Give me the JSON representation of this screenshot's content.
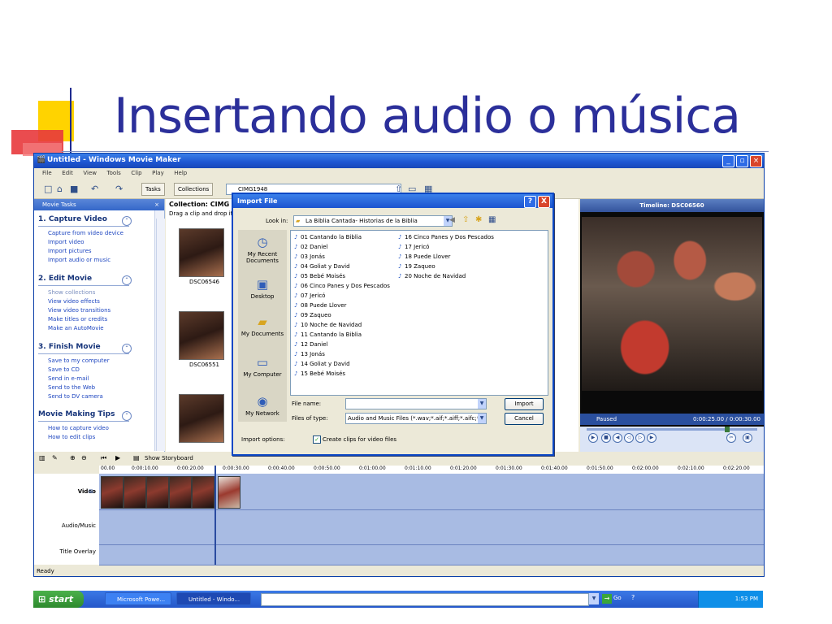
{
  "slide": {
    "title": "Insertando audio o música"
  },
  "window": {
    "title": "Untitled - Windows Movie Maker",
    "menu": [
      "File",
      "Edit",
      "View",
      "Tools",
      "Clip",
      "Play",
      "Help"
    ],
    "toolbar": {
      "tasks": "Tasks",
      "collections": "Collections",
      "collection_select": "CIMG1948"
    }
  },
  "tasks_pane": {
    "header": "Movie Tasks",
    "sections": [
      {
        "title": "1. Capture Video",
        "links": [
          "Capture from video device",
          "Import video",
          "Import pictures",
          "Import audio or music"
        ]
      },
      {
        "title": "2. Edit Movie",
        "links": [
          "Show collections",
          "View video effects",
          "View video transitions",
          "Make titles or credits",
          "Make an AutoMovie"
        ]
      },
      {
        "title": "3. Finish Movie",
        "links": [
          "Save to my computer",
          "Save to CD",
          "Send in e-mail",
          "Send to the Web",
          "Send to DV camera"
        ]
      },
      {
        "title": "Movie Making Tips",
        "links": [
          "How to capture video",
          "How to edit clips"
        ]
      }
    ]
  },
  "collection": {
    "title": "Collection: CIMG",
    "hint": "Drag a clip and drop it o",
    "items": [
      "DSC06546",
      "DSC06551"
    ]
  },
  "preview": {
    "header": "Timeline: DSC06560",
    "status": "Paused",
    "time": "0:00:25.00 / 0:00:30.00"
  },
  "dialog": {
    "title": "Import File",
    "look_in_label": "Look in:",
    "look_in_value": "La Biblia Cantada- Historias de la Biblia",
    "places": [
      "My Recent Documents",
      "Desktop",
      "My Documents",
      "My Computer",
      "My Network"
    ],
    "files_col1": [
      "01 Cantando la Biblia",
      "02 Daniel",
      "03 Jonás",
      "04 Goliat y David",
      "05 Bebé Moisés",
      "06 Cinco Panes y Dos Pescados",
      "07 Jericó",
      "08 Puede Llover",
      "09 Zaqueo",
      "10 Noche de Navidad",
      "11 Cantando la Biblia",
      "12 Daniel",
      "13 Jonás",
      "14 Goliat y David",
      "15 Bebé Moisés"
    ],
    "files_col2": [
      "16 Cinco Panes y Dos Pescados",
      "17 Jericó",
      "18 Puede Llover",
      "19 Zaqueo",
      "20 Noche de Navidad"
    ],
    "file_name_label": "File name:",
    "file_name_value": "",
    "files_of_type_label": "Files of type:",
    "files_of_type_value": "Audio and Music Files (*.wav;*.aif;*.aiff;*.aifc;*.s",
    "import_label": "Import",
    "cancel_label": "Cancel",
    "import_options_label": "Import options:",
    "create_clips_label": "Create clips for video files",
    "create_clips_checked": true,
    "help_button": "?",
    "close_button": "X"
  },
  "timeline": {
    "show_storyboard": "Show Storyboard",
    "ruler": [
      "00.00",
      "0:00:10.00",
      "0:00:20.00",
      "0:00:30.00",
      "0:00:40.00",
      "0:00:50.00",
      "0:01:00.00",
      "0:01:10.00",
      "0:01:20.00",
      "0:01:30.00",
      "0:01:40.00",
      "0:01:50.00",
      "0:02:00.00",
      "0:02:10.00",
      "0:02:20.00"
    ],
    "tracks": [
      "Video",
      "Audio/Music",
      "Title Overlay"
    ]
  },
  "status_bar": {
    "text": "Ready"
  },
  "taskbar": {
    "start": "start",
    "apps": [
      "Microsoft Powe...",
      "Untitled - Windo..."
    ],
    "go": "Go",
    "clock": "1:53 PM"
  }
}
